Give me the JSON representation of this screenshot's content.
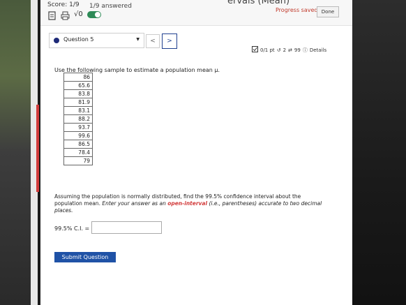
{
  "header": {
    "score": "Score: 1/9",
    "answered": "1/9 answered",
    "title_fragment": "ervals (Mean)",
    "progress_text": "Progress saved",
    "done_label": "Done",
    "sqrt_label": "√0"
  },
  "nav": {
    "question_label": "Question 5",
    "prev_symbol": "<",
    "next_symbol": ">",
    "points": "0/1 pt",
    "retries": "2",
    "attempts": "99",
    "details": "Details"
  },
  "problem": {
    "intro": "Use the following sample to estimate a population mean μ.",
    "sample": [
      "86",
      "65.6",
      "83.8",
      "81.9",
      "83.1",
      "88.2",
      "93.7",
      "99.6",
      "86.5",
      "78.4",
      "79"
    ],
    "text_plain": "Assuming the population is normally distributed, find the 99.5% confidence interval about the population mean. ",
    "text_italic_a": "Enter your answer as an ",
    "text_emphasis": "open-interval",
    "text_italic_b": " (i.e., parentheses) accurate to two decimal places.",
    "ci_label": "99.5% C.I. =",
    "ci_value": "",
    "submit_label": "Submit Question"
  },
  "colors": {
    "accent_blue": "#1f52a6",
    "emphasis_red": "#d23b3b",
    "toggle_green": "#2e8b57"
  }
}
